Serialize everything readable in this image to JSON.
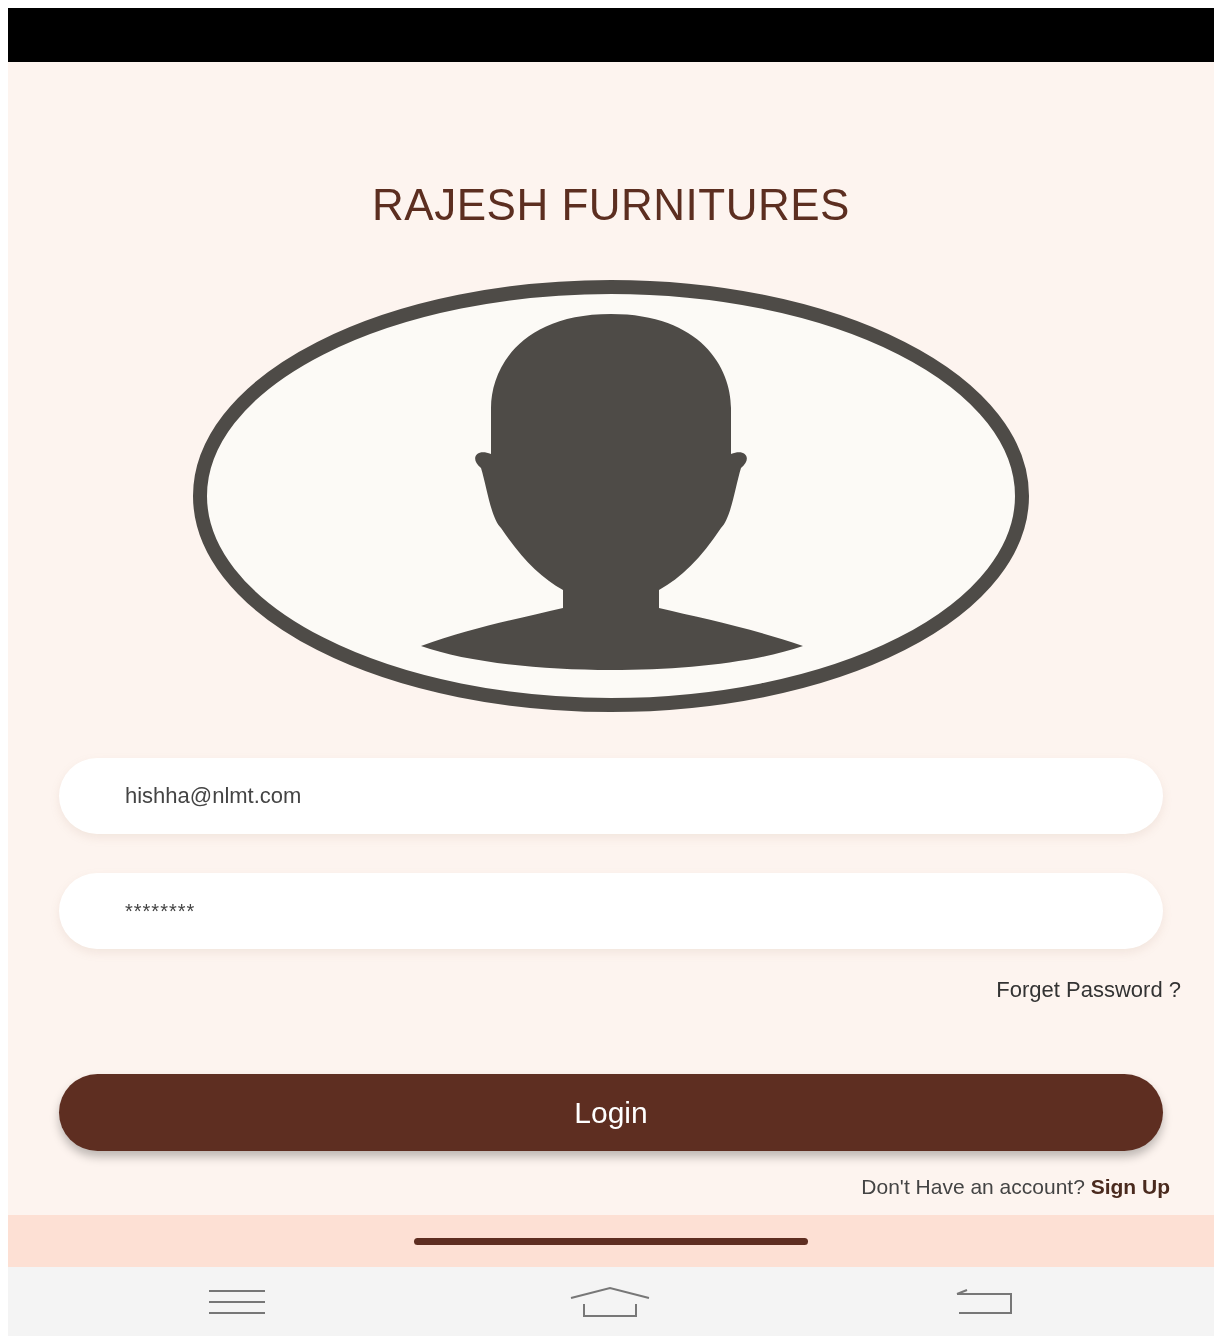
{
  "app_title": "RAJESH FURNITURES",
  "avatar": {
    "kind": "silhouette"
  },
  "fields": [
    {
      "kind": "email",
      "value": "hishha@nlmt.com"
    },
    {
      "kind": "password",
      "value": "********"
    }
  ],
  "forgot_link": "Forget Password ?",
  "login_button": "Login",
  "signup_prompt": {
    "text": "Don't Have an account?",
    "link": "Sign Up"
  }
}
